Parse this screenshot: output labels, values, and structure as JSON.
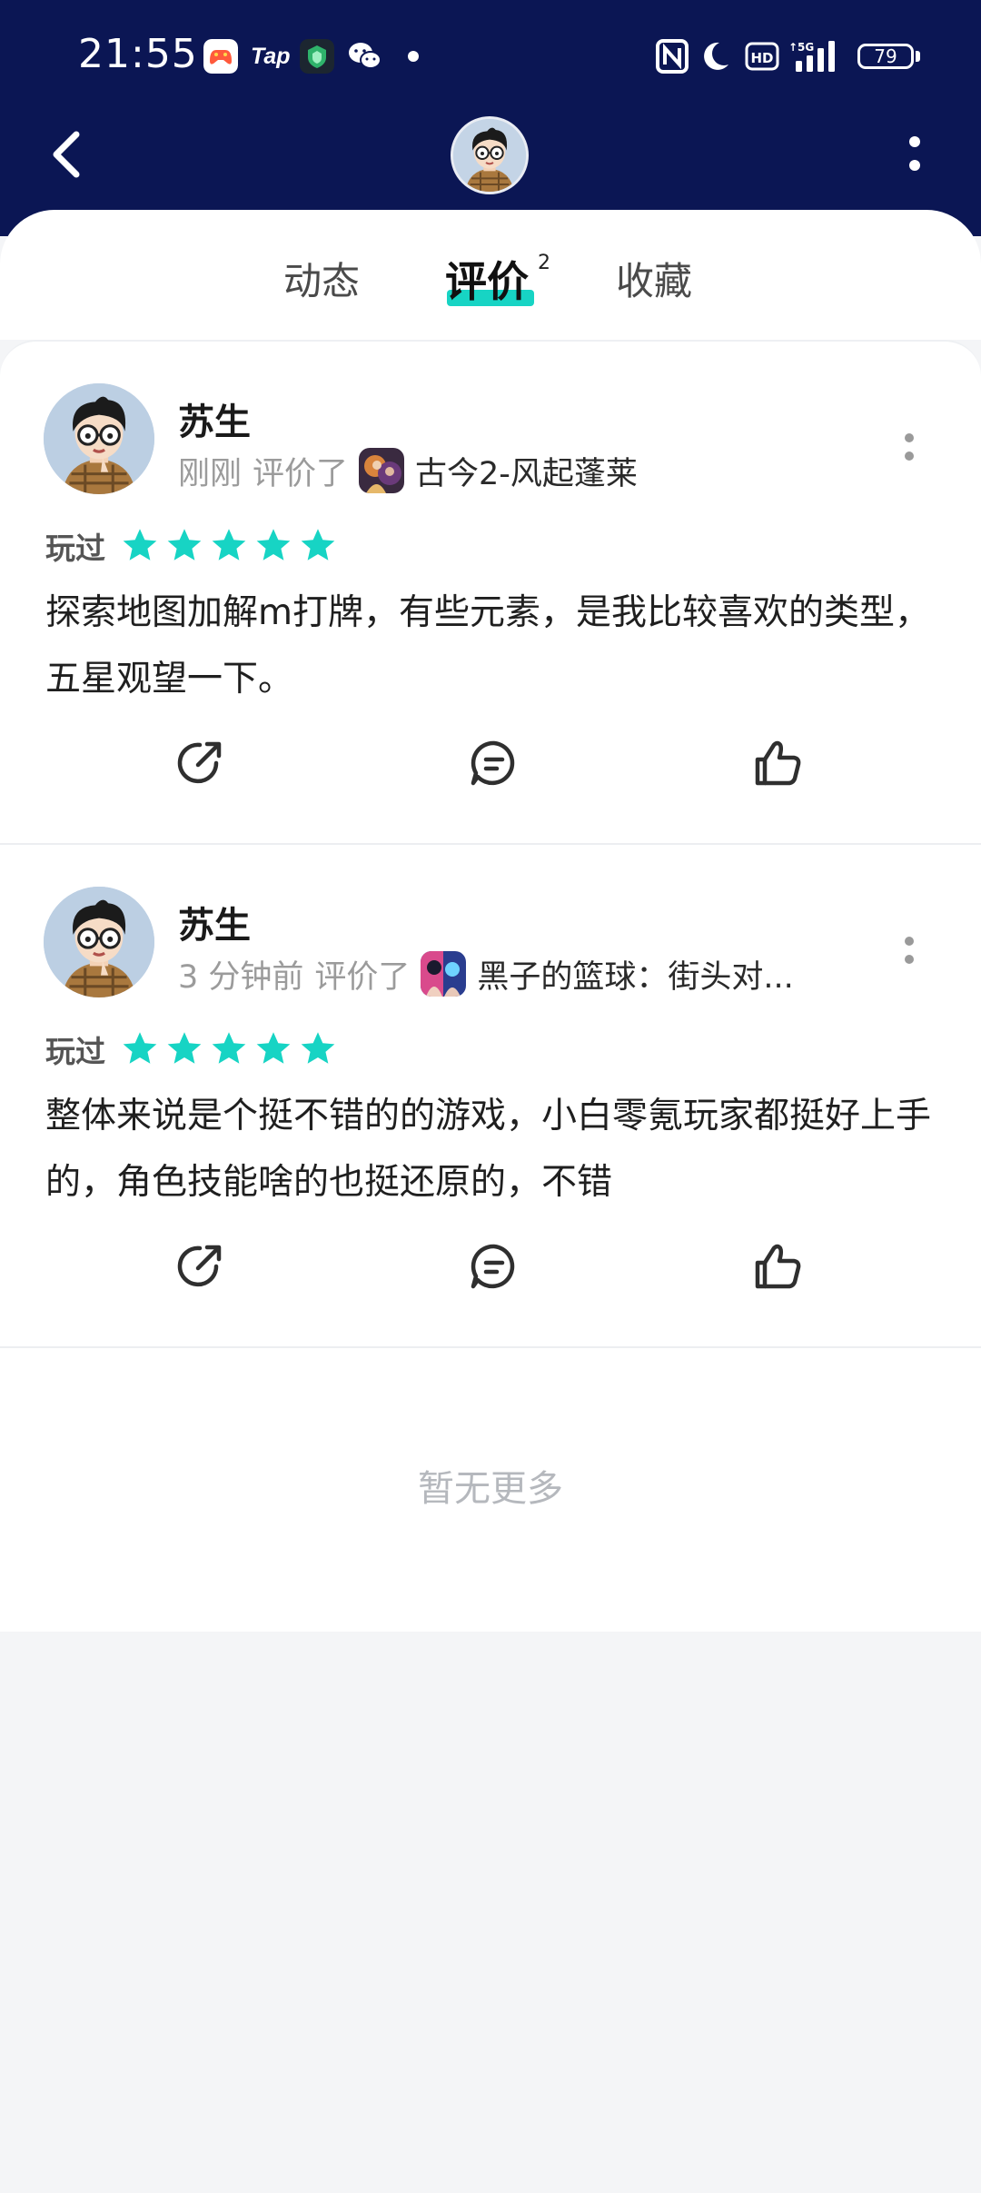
{
  "status_bar": {
    "time": "21:55",
    "battery": "79",
    "icons": [
      "game-center-icon",
      "taptap-icon",
      "security-app-icon",
      "wechat-icon",
      "notification-dot-icon",
      "nfc-icon",
      "do-not-disturb-moon-icon",
      "hd-icon",
      "5g-signal-icon",
      "battery-icon"
    ],
    "tap_label": "Tap"
  },
  "nav": {
    "back_icon": "chevron-left-icon",
    "more_icon": "vertical-dots-icon"
  },
  "tabs": [
    {
      "label": "动态"
    },
    {
      "label": "评价",
      "badge": "2",
      "active": true
    },
    {
      "label": "收藏"
    }
  ],
  "reviews": [
    {
      "user": "苏生",
      "time": "刚刚",
      "action": "评价了",
      "game": "古今2-风起蓬莱",
      "played_label": "玩过",
      "stars": 5,
      "content": "探索地图加解m打牌，有些元素，是我比较喜欢的类型，五星观望一下。"
    },
    {
      "user": "苏生",
      "time": "3 分钟前",
      "action": "评价了",
      "game": "黑子的篮球：街头对...",
      "played_label": "玩过",
      "stars": 5,
      "content": "整体来说是个挺不错的的游戏，小白零氪玩家都挺好上手的，角色技能啥的也挺还原的，不错"
    }
  ],
  "footer": {
    "no_more": "暂无更多"
  },
  "colors": {
    "header_bg": "#0b1654",
    "accent": "#17d4c4",
    "page_bg": "#f4f5f7"
  }
}
